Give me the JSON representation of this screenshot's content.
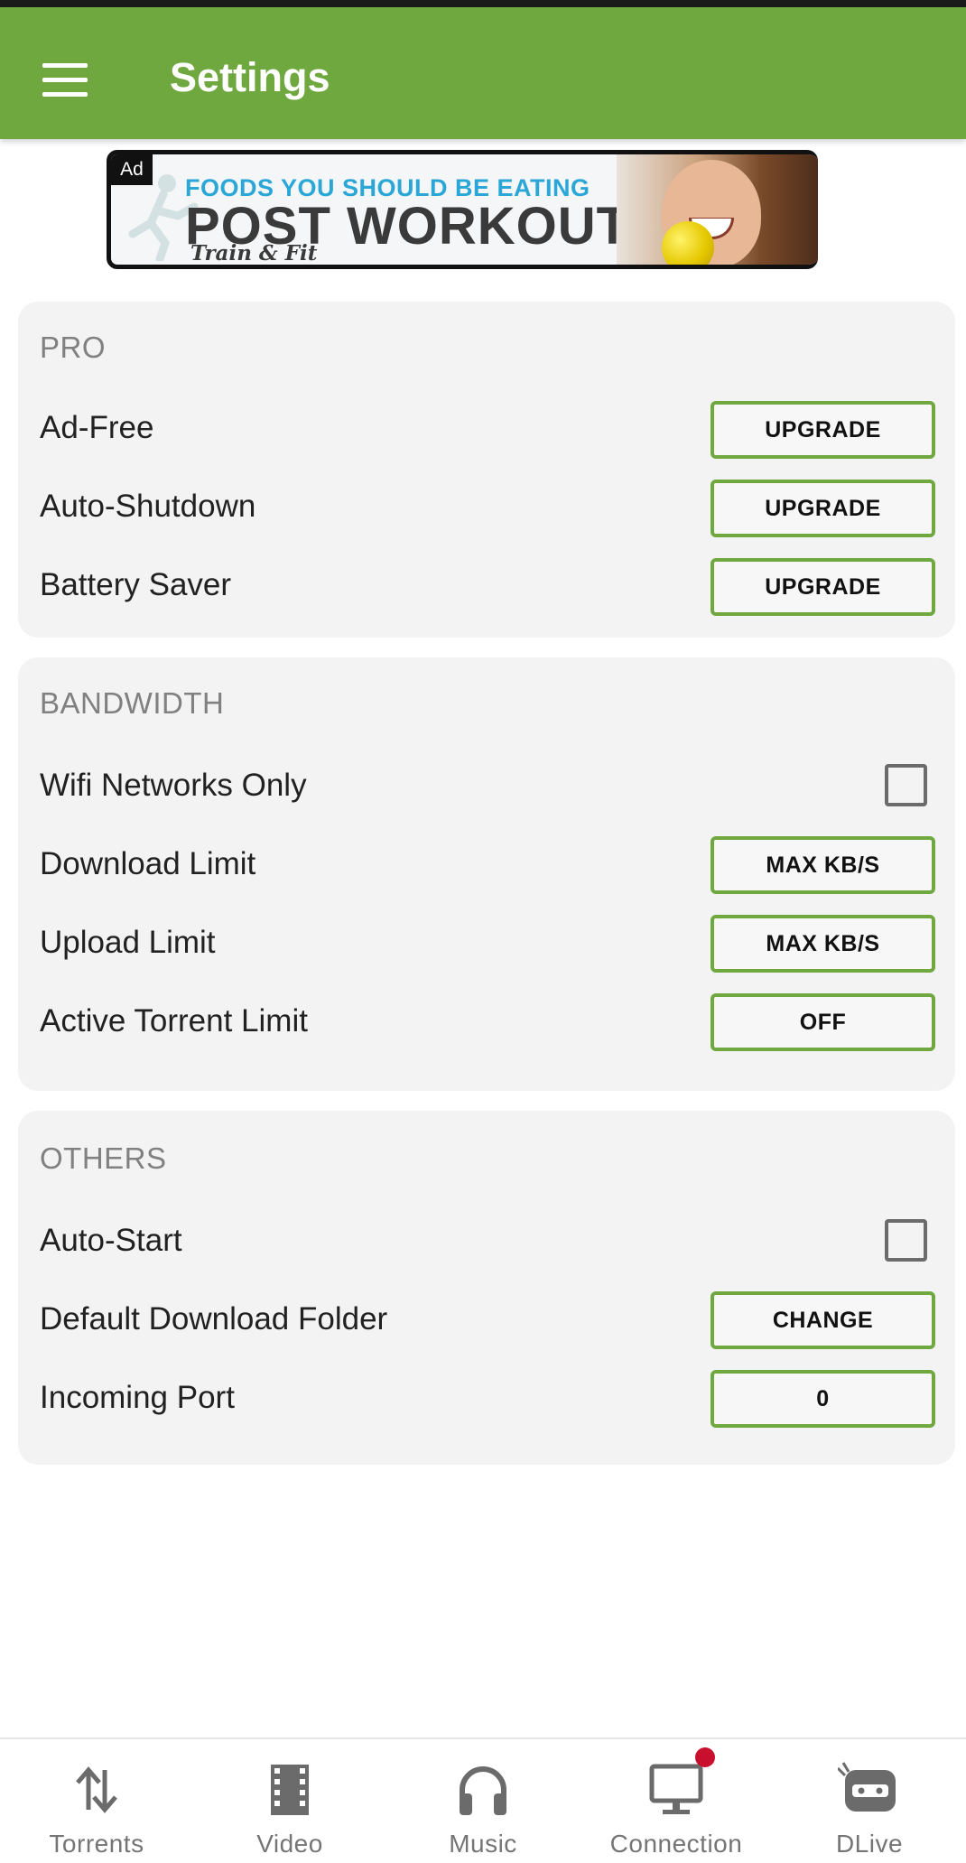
{
  "app": {
    "title": "Settings",
    "accent_color": "#6fa83f"
  },
  "header": {
    "menu_icon": "hamburger-menu-icon",
    "title": "Settings"
  },
  "ad": {
    "badge": "Ad",
    "line1": "FOODS YOU SHOULD BE EATING",
    "line2": "POST WORKOUT",
    "line3": "Train & Fit"
  },
  "sections": {
    "pro": {
      "title": "PRO",
      "rows": [
        {
          "label": "Ad-Free",
          "button": "UPGRADE"
        },
        {
          "label": "Auto-Shutdown",
          "button": "UPGRADE"
        },
        {
          "label": "Battery Saver",
          "button": "UPGRADE"
        }
      ]
    },
    "bandwidth": {
      "title": "BANDWIDTH",
      "wifi_only": {
        "label": "Wifi Networks Only",
        "checked": false
      },
      "rows": [
        {
          "label": "Download Limit",
          "button": "MAX KB/S"
        },
        {
          "label": "Upload Limit",
          "button": "MAX KB/S"
        },
        {
          "label": "Active Torrent Limit",
          "button": "OFF"
        }
      ]
    },
    "others": {
      "title": "OTHERS",
      "auto_start": {
        "label": "Auto-Start",
        "checked": false
      },
      "rows": [
        {
          "label": "Default Download Folder",
          "button": "CHANGE"
        },
        {
          "label": "Incoming Port",
          "button": "0"
        }
      ]
    }
  },
  "bottom_nav": {
    "items": [
      {
        "label": "Torrents",
        "icon": "transfer-arrows-icon"
      },
      {
        "label": "Video",
        "icon": "film-strip-icon"
      },
      {
        "label": "Music",
        "icon": "headphones-icon"
      },
      {
        "label": "Connection",
        "icon": "monitor-icon",
        "has_notification": true
      },
      {
        "label": "DLive",
        "icon": "dlive-mascot-icon"
      }
    ]
  }
}
